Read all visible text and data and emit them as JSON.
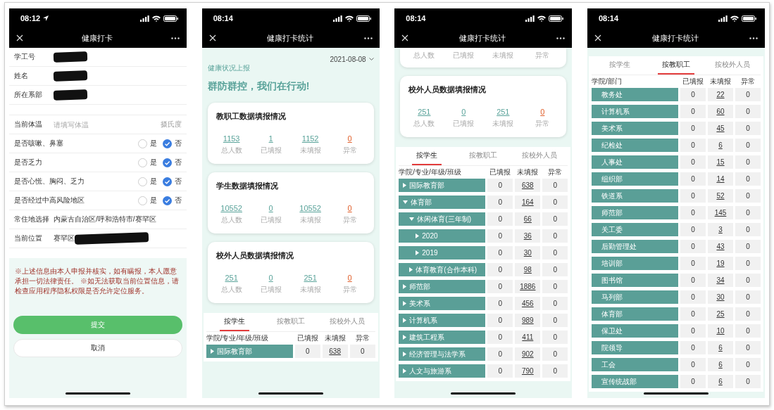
{
  "screens": [
    {
      "kind": "form",
      "time": "08:12",
      "location_on": true,
      "title": "健康打卡",
      "identity": [
        {
          "label": "学工号",
          "redacted": true
        },
        {
          "label": "姓名",
          "redacted": true
        },
        {
          "label": "所在系部",
          "redacted": true
        }
      ],
      "temperature": {
        "label": "当前体温",
        "placeholder": "请填写体温",
        "unit": "摄氏度"
      },
      "questions": [
        {
          "label": "是否咳嗽、鼻塞",
          "options": [
            {
              "label": "是",
              "selected": false
            },
            {
              "label": "否",
              "selected": true
            }
          ]
        },
        {
          "label": "是否乏力",
          "options": [
            {
              "label": "是",
              "selected": false
            },
            {
              "label": "否",
              "selected": true
            }
          ]
        },
        {
          "label": "是否心慌、胸闷、乏力",
          "options": [
            {
              "label": "是",
              "selected": false
            },
            {
              "label": "否",
              "selected": true
            }
          ]
        },
        {
          "label": "是否经过中高风险地区",
          "options": [
            {
              "label": "是",
              "selected": false
            },
            {
              "label": "否",
              "selected": true
            }
          ]
        }
      ],
      "location_rows": [
        {
          "label": "常住地选择",
          "value": "内蒙古自治区/呼和浩特市/赛罕区"
        },
        {
          "label": "当前位置",
          "value": "赛罕区",
          "redacted": true
        }
      ],
      "notice": "※上述信息由本人申报并核实，如有瞒报，本人愿意承担一切法律责任。 ※如无法获取当前位置信息，请检查应用程序隐私权限是否允许定位服务。",
      "buttons": [
        {
          "label": "提交",
          "kind": "primary"
        },
        {
          "label": "取消",
          "kind": "secondary"
        }
      ]
    },
    {
      "kind": "stats",
      "time": "08:14",
      "title": "健康打卡统计",
      "date": "2021-08-08",
      "subtitle": "健康状况上报",
      "slogan": "群防群控，我们在行动!",
      "cards": [
        {
          "title": "教职工数据填报情况",
          "stats": [
            {
              "value": "1153",
              "label": "总人数",
              "alert": false
            },
            {
              "value": "1",
              "label": "已填报",
              "alert": false
            },
            {
              "value": "1152",
              "label": "未填报",
              "alert": false
            },
            {
              "value": "0",
              "label": "异常",
              "alert": true
            }
          ]
        },
        {
          "title": "学生数据填报情况",
          "stats": [
            {
              "value": "10552",
              "label": "总人数",
              "alert": false
            },
            {
              "value": "0",
              "label": "已填报",
              "alert": false
            },
            {
              "value": "10552",
              "label": "未填报",
              "alert": false
            },
            {
              "value": "0",
              "label": "异常",
              "alert": true
            }
          ]
        },
        {
          "title": "校外人员数据填报情况",
          "stats": [
            {
              "value": "251",
              "label": "总人数",
              "alert": false
            },
            {
              "value": "0",
              "label": "已填报",
              "alert": false
            },
            {
              "value": "251",
              "label": "未填报",
              "alert": false
            },
            {
              "value": "0",
              "label": "异常",
              "alert": true
            }
          ]
        }
      ],
      "tabs": [
        {
          "label": "按学生",
          "selected": true
        },
        {
          "label": "按教职工",
          "selected": false
        },
        {
          "label": "按校外人员",
          "selected": false
        }
      ],
      "table": {
        "columns": [
          "学院/专业/年级/班级",
          "已填报",
          "未填报",
          "异常"
        ],
        "rows": [
          {
            "name": "国际教育部",
            "expanded": false,
            "filled": "0",
            "unfilled": "638",
            "abnormal": "0"
          }
        ]
      }
    },
    {
      "kind": "stats",
      "time": "08:14",
      "title": "健康打卡统计",
      "partial_card_labels": [
        "总人数",
        "已填报",
        "未填报",
        "异常"
      ],
      "cards": [
        {
          "title": "校外人员数据填报情况",
          "stats": [
            {
              "value": "251",
              "label": "总人数",
              "alert": false
            },
            {
              "value": "0",
              "label": "已填报",
              "alert": false
            },
            {
              "value": "251",
              "label": "未填报",
              "alert": false
            },
            {
              "value": "0",
              "label": "异常",
              "alert": true
            }
          ]
        }
      ],
      "tabs": [
        {
          "label": "按学生",
          "selected": true
        },
        {
          "label": "按教职工",
          "selected": false
        },
        {
          "label": "按校外人员",
          "selected": false
        }
      ],
      "table": {
        "columns": [
          "学院/专业/年级/班级",
          "已填报",
          "未填报",
          "异常"
        ],
        "rows": [
          {
            "name": "国际教育部",
            "expanded": false,
            "filled": "0",
            "unfilled": "638",
            "abnormal": "0"
          },
          {
            "name": "体育部",
            "expanded": true,
            "filled": "0",
            "unfilled": "164",
            "abnormal": "0",
            "children": [
              {
                "name": "休闲体育(三年制)",
                "expanded": true,
                "filled": "0",
                "unfilled": "66",
                "abnormal": "0",
                "children": [
                  {
                    "name": "2020",
                    "expanded": false,
                    "filled": "0",
                    "unfilled": "36",
                    "abnormal": "0"
                  },
                  {
                    "name": "2019",
                    "expanded": false,
                    "filled": "0",
                    "unfilled": "30",
                    "abnormal": "0"
                  }
                ]
              },
              {
                "name": "体育教育(合作本科)",
                "expanded": false,
                "filled": "0",
                "unfilled": "98",
                "abnormal": "0"
              }
            ]
          },
          {
            "name": "师范部",
            "expanded": false,
            "filled": "0",
            "unfilled": "1886",
            "abnormal": "0"
          },
          {
            "name": "美术系",
            "expanded": false,
            "filled": "0",
            "unfilled": "456",
            "abnormal": "0"
          },
          {
            "name": "计算机系",
            "expanded": false,
            "filled": "0",
            "unfilled": "989",
            "abnormal": "0"
          },
          {
            "name": "建筑工程系",
            "expanded": false,
            "filled": "0",
            "unfilled": "411",
            "abnormal": "0"
          },
          {
            "name": "经济管理与法学系",
            "expanded": false,
            "filled": "0",
            "unfilled": "902",
            "abnormal": "0"
          },
          {
            "name": "人文与旅游系",
            "expanded": false,
            "filled": "0",
            "unfilled": "790",
            "abnormal": "0"
          }
        ]
      }
    },
    {
      "kind": "stats",
      "time": "08:14",
      "title": "健康打卡统计",
      "tabs": [
        {
          "label": "按学生",
          "selected": false
        },
        {
          "label": "按教职工",
          "selected": true
        },
        {
          "label": "按校外人员",
          "selected": false
        }
      ],
      "table": {
        "columns": [
          "学院/部门",
          "已填报",
          "未填报",
          "异常"
        ],
        "rows": [
          {
            "name": "教务处",
            "filled": "0",
            "unfilled": "22",
            "abnormal": "0"
          },
          {
            "name": "计算机系",
            "filled": "0",
            "unfilled": "60",
            "abnormal": "0"
          },
          {
            "name": "美术系",
            "filled": "0",
            "unfilled": "45",
            "abnormal": "0"
          },
          {
            "name": "纪检处",
            "filled": "0",
            "unfilled": "6",
            "abnormal": "0"
          },
          {
            "name": "人事处",
            "filled": "0",
            "unfilled": "15",
            "abnormal": "0"
          },
          {
            "name": "组织部",
            "filled": "0",
            "unfilled": "14",
            "abnormal": "0"
          },
          {
            "name": "铁道系",
            "filled": "0",
            "unfilled": "52",
            "abnormal": "0"
          },
          {
            "name": "师范部",
            "filled": "0",
            "unfilled": "145",
            "abnormal": "0"
          },
          {
            "name": "关工委",
            "filled": "0",
            "unfilled": "3",
            "abnormal": "0"
          },
          {
            "name": "后勤管理处",
            "filled": "0",
            "unfilled": "43",
            "abnormal": "0"
          },
          {
            "name": "培训部",
            "filled": "0",
            "unfilled": "19",
            "abnormal": "0"
          },
          {
            "name": "图书馆",
            "filled": "0",
            "unfilled": "34",
            "abnormal": "0"
          },
          {
            "name": "马列部",
            "filled": "0",
            "unfilled": "30",
            "abnormal": "0"
          },
          {
            "name": "体育部",
            "filled": "0",
            "unfilled": "25",
            "abnormal": "0"
          },
          {
            "name": "保卫处",
            "filled": "0",
            "unfilled": "10",
            "abnormal": "0"
          },
          {
            "name": "院领导",
            "filled": "0",
            "unfilled": "6",
            "abnormal": "0"
          },
          {
            "name": "工会",
            "filled": "0",
            "unfilled": "6",
            "abnormal": "0"
          },
          {
            "name": "宣传统战部",
            "filled": "0",
            "unfilled": "6",
            "abnormal": "0"
          }
        ]
      }
    }
  ]
}
